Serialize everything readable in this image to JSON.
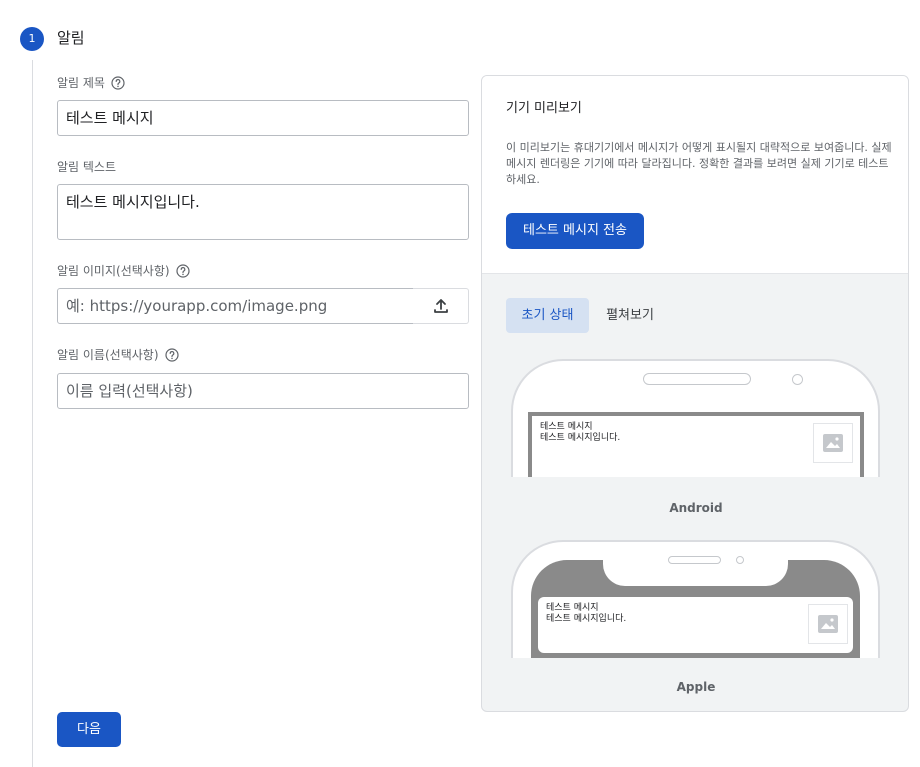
{
  "step": {
    "number": "1",
    "title": "알림"
  },
  "form": {
    "title_field": {
      "label": "알림 제목",
      "value": "테스트 메시지"
    },
    "text_field": {
      "label": "알림 텍스트",
      "value": "테스트 메시지입니다."
    },
    "image_field": {
      "label": "알림 이미지(선택사항)",
      "placeholder": "예: https://yourapp.com/image.png"
    },
    "name_field": {
      "label": "알림 이름(선택사항)",
      "placeholder": "이름 입력(선택사항)"
    },
    "next_button": "다음"
  },
  "preview": {
    "title": "기기 미리보기",
    "description": "이 미리보기는 휴대기기에서 메시지가 어떻게 표시될지 대략적으로 보여줍니다. 실제 메시지 렌더링은 기기에 따라 달라집니다. 정확한 결과를 보려면 실제 기기로 테스트하세요.",
    "send_button": "테스트 메시지 전송",
    "tabs": {
      "initial": "초기 상태",
      "expanded": "펼쳐보기"
    },
    "android": {
      "notif_title": "테스트 메시지",
      "notif_body": "테스트 메시지입니다.",
      "label": "Android"
    },
    "apple": {
      "notif_title": "테스트 메시지",
      "notif_body": "테스트 메시지입니다.",
      "label": "Apple"
    }
  },
  "icons": {
    "help": "help-circle-icon",
    "upload": "upload-icon",
    "image": "image-placeholder-icon"
  },
  "colors": {
    "primary": "#1a56c4",
    "tab_active_bg": "#d5e1f2"
  }
}
